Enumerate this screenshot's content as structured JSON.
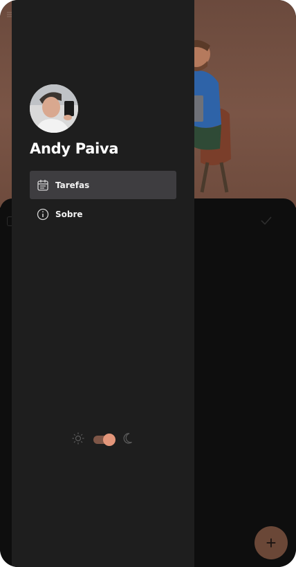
{
  "drawer": {
    "user_name": "Andy Paiva",
    "items": [
      {
        "label": "Tarefas",
        "icon": "calendar-list-icon",
        "active": true
      },
      {
        "label": "Sobre",
        "icon": "info-icon",
        "active": false
      }
    ],
    "theme": {
      "light_icon": "sun-icon",
      "dark_icon": "moon-icon",
      "dark_mode_on": true
    }
  },
  "background": {
    "fab_label": "+"
  },
  "colors": {
    "drawer_bg": "#1e1e1e",
    "active_item_bg": "#3e3d40",
    "accent": "#e3967a",
    "fab_bg": "#6a4737"
  }
}
